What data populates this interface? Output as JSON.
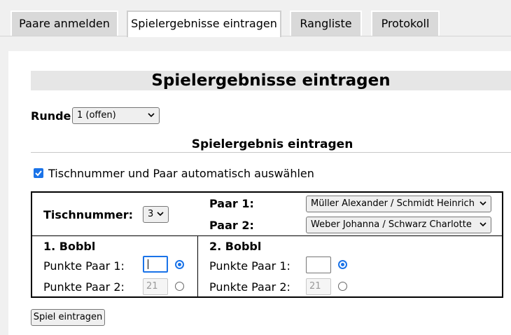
{
  "tabs": [
    {
      "label": "Paare anmelden",
      "active": false
    },
    {
      "label": "Spielergebnisse eintragen",
      "active": true
    },
    {
      "label": "Rangliste",
      "active": false
    },
    {
      "label": "Protokoll",
      "active": false
    }
  ],
  "page": {
    "title": "Spielergebnisse eintragen"
  },
  "runde": {
    "label": "Runde:",
    "selected": "1 (offen)"
  },
  "section": {
    "title": "Spielergebnis eintragen"
  },
  "auto_select": {
    "label": "Tischnummer und Paar automatisch auswählen",
    "checked": true
  },
  "table": {
    "tisch_label": "Tischnummer:",
    "tisch_value": "3",
    "paar1_label": "Paar 1:",
    "paar1_value": "Müller Alexander / Schmidt Heinrich",
    "paar2_label": "Paar 2:",
    "paar2_value": "Weber Johanna / Schwarz Charlotte"
  },
  "bobbl1": {
    "title": "1. Bobbl",
    "p1_label": "Punkte Paar 1:",
    "p1_value": "",
    "p2_label": "Punkte Paar 2:",
    "p2_value": "21"
  },
  "bobbl2": {
    "title": "2. Bobbl",
    "p1_label": "Punkte Paar 1:",
    "p1_value": "",
    "p2_label": "Punkte Paar 2:",
    "p2_value": "21"
  },
  "submit": {
    "label": "Spiel eintragen"
  },
  "colors": {
    "accent": "#1a73e8",
    "tab_inactive": "#d9d9d9",
    "title_bar": "#e6e6e6"
  }
}
